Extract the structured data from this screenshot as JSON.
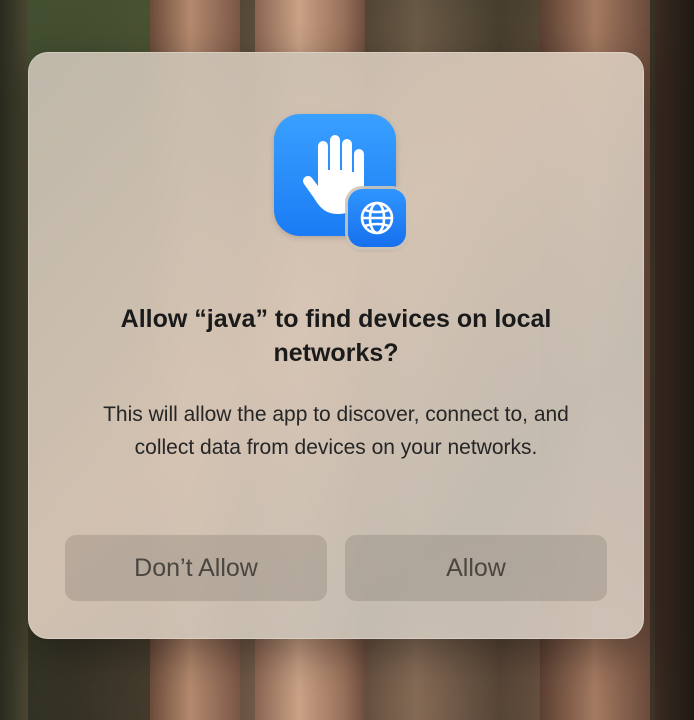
{
  "dialog": {
    "title": "Allow “java” to find devices on local networks?",
    "message": "This will allow the app to discover, connect to, and collect data from devices on your networks.",
    "app_icon": "hand-raised-icon",
    "badge_icon": "globe-icon",
    "buttons": {
      "deny_label": "Don’t Allow",
      "allow_label": "Allow"
    }
  },
  "colors": {
    "icon_blue": "#1a7cf5",
    "dialog_bg": "#cfc3b5"
  }
}
